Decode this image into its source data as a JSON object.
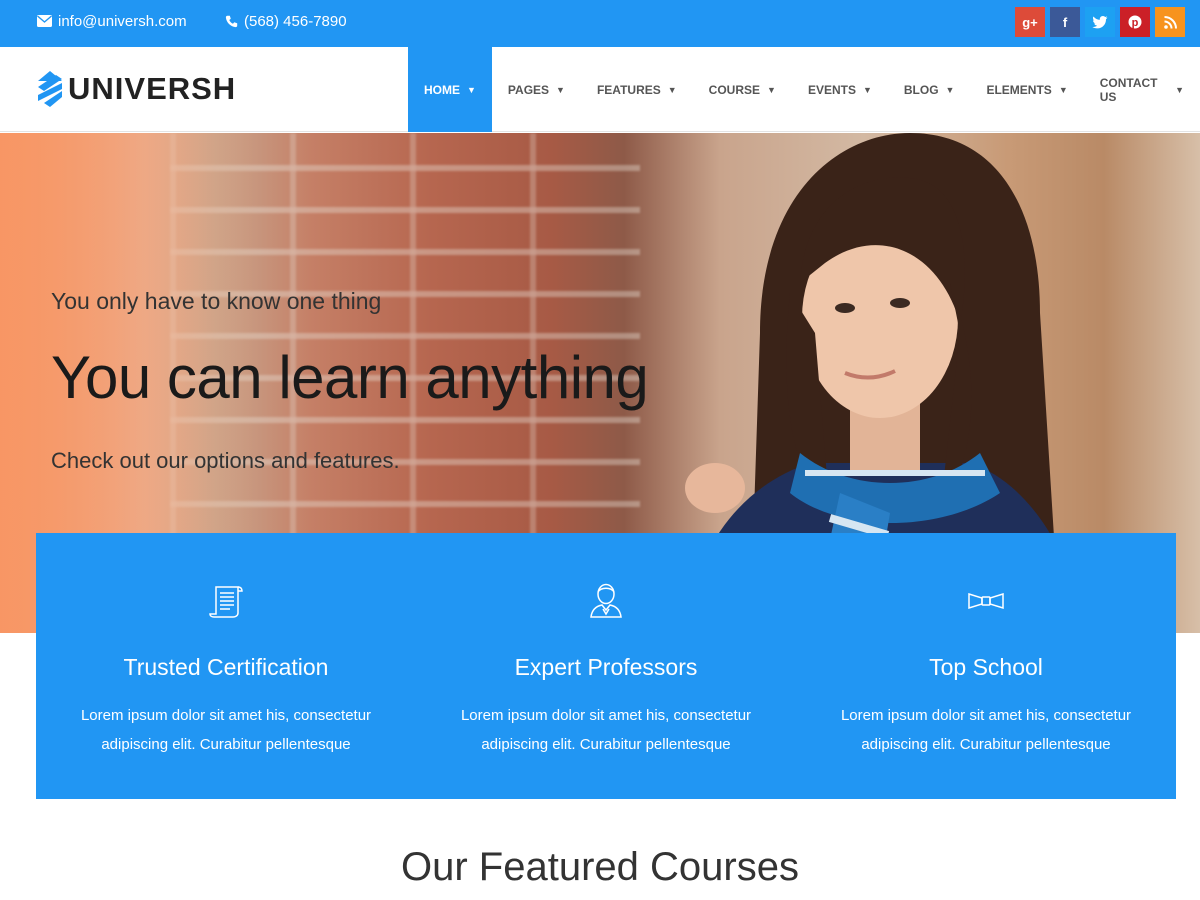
{
  "topbar": {
    "email": "info@universh.com",
    "phone": "(568) 456-7890",
    "social": [
      {
        "name": "google-plus",
        "label": "g+",
        "color": "#dd4b39"
      },
      {
        "name": "facebook",
        "label": "f",
        "color": "#3b5998"
      },
      {
        "name": "twitter",
        "label": "t",
        "color": "#1da1f2"
      },
      {
        "name": "pinterest",
        "label": "p",
        "color": "#cb2027"
      },
      {
        "name": "rss",
        "label": "rss",
        "color": "#f7931e"
      }
    ]
  },
  "header": {
    "logo_text": "UNIVERSH",
    "nav": [
      {
        "label": "HOME",
        "active": true
      },
      {
        "label": "PAGES"
      },
      {
        "label": "FEATURES"
      },
      {
        "label": "COURSE"
      },
      {
        "label": "EVENTS"
      },
      {
        "label": "BLOG"
      },
      {
        "label": "ELEMENTS"
      },
      {
        "label": "CONTACT US"
      }
    ]
  },
  "hero": {
    "subtitle": "You only have to know one thing",
    "title": "You can learn anything",
    "description": "Check out our options and features."
  },
  "features": [
    {
      "icon": "certificate-scroll-icon",
      "title": "Trusted Certification",
      "text": "Lorem ipsum dolor sit amet his, consectetur adipiscing elit. Curabitur pellentesque"
    },
    {
      "icon": "professor-icon",
      "title": "Expert Professors",
      "text": "Lorem ipsum dolor sit amet his, consectetur adipiscing elit. Curabitur pellentesque"
    },
    {
      "icon": "bow-tie-icon",
      "title": "Top School",
      "text": "Lorem ipsum dolor sit amet his, consectetur adipiscing elit. Curabitur pellentesque"
    }
  ],
  "section": {
    "featured_title": "Our Featured Courses"
  },
  "colors": {
    "primary": "#2196f3"
  }
}
